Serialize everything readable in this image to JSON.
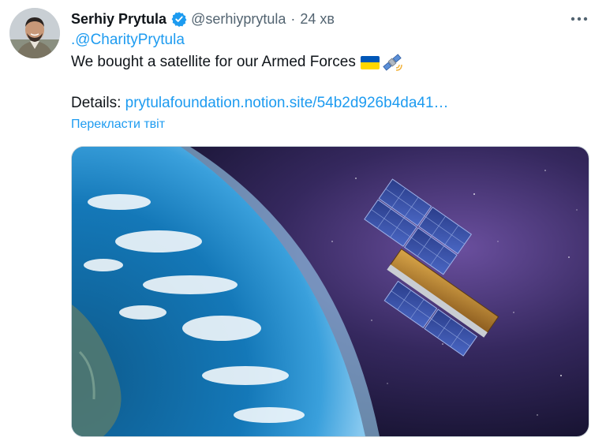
{
  "author": {
    "name": "Serhiy Prytula",
    "handle": "@serhiyprytula",
    "separator": "·",
    "time": "24 хв",
    "verified": true,
    "avatar_icon": "avatar-photo"
  },
  "tweet": {
    "mention": ".@CharityPrytula",
    "text": "We bought a satellite for our Armed Forces",
    "emojis": [
      "ukraine-flag-icon",
      "satellite-icon"
    ],
    "details_label": "Details: ",
    "details_link": "prytulafoundation.notion.site/54b2d926b4da41…"
  },
  "translate_label": "Перекласти твіт",
  "more_icon": "more-options-icon",
  "media": {
    "icon": "satellite-over-earth-image"
  },
  "colors": {
    "link": "#1d9bf0",
    "secondary": "#536471",
    "text": "#0f1419",
    "verified": "#1d9bf0"
  }
}
